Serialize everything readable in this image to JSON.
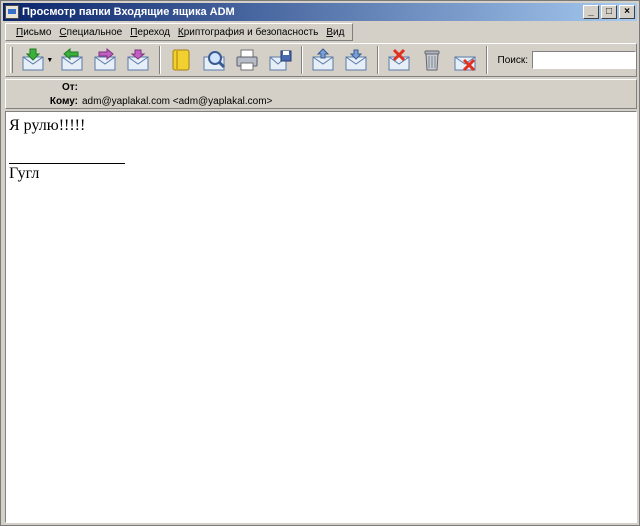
{
  "window": {
    "title": "Просмотр папки Входящие ящика ADM"
  },
  "menu": [
    {
      "u": "П",
      "rest": "исьмо"
    },
    {
      "u": "С",
      "rest": "пециальное"
    },
    {
      "u": "П",
      "rest": "ереход"
    },
    {
      "u": "К",
      "rest": "риптография и безопасность"
    },
    {
      "u": "В",
      "rest": "ид"
    }
  ],
  "toolbar": {
    "search_label": "Поиск:",
    "search_value": "",
    "icons": [
      "receive-mail-icon",
      "reply-icon",
      "forward-icon",
      "new-message-icon",
      "address-book-icon",
      "find-icon",
      "print-icon",
      "save-icon",
      "move-icon",
      "copy-icon",
      "delete-message-icon",
      "trash-icon",
      "junk-icon"
    ]
  },
  "headers": {
    "from_label": "От:",
    "from_value": "",
    "to_label": "Кому:",
    "to_value": "adm@yaplakal.com <adm@yaplakal.com>"
  },
  "message": {
    "line1": "Я рулю!!!!!",
    "signature": "Гугл"
  },
  "colors": {
    "titlebar_start": "#0a246a",
    "titlebar_end": "#a6caf0",
    "chrome": "#d4d0c8"
  }
}
